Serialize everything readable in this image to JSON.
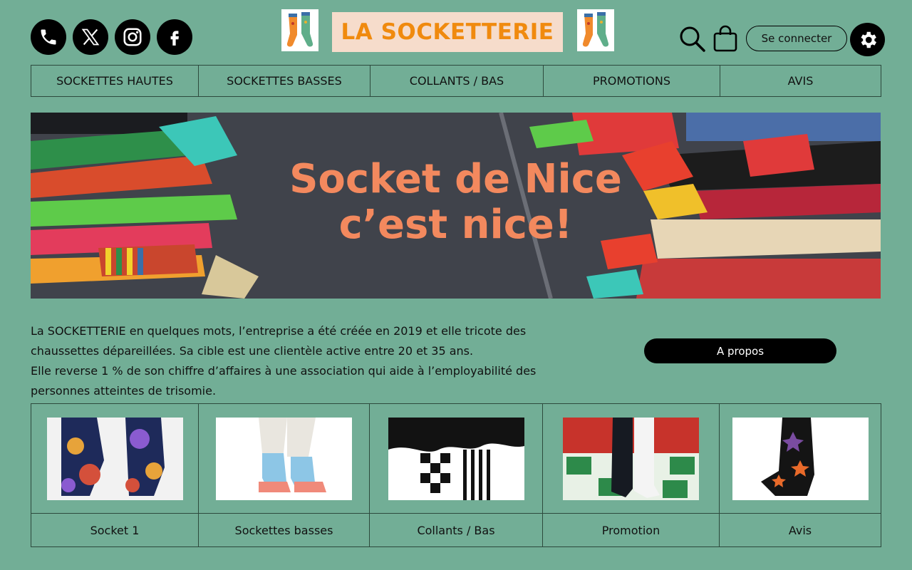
{
  "header": {
    "logo_text": "LA SOCKETTERIE",
    "social_icons": [
      "phone-icon",
      "x-icon",
      "instagram-icon",
      "facebook-icon"
    ],
    "login_label": "Se connecter"
  },
  "nav": {
    "items": [
      {
        "label": "SOCKETTES HAUTES"
      },
      {
        "label": "SOCKETTES BASSES"
      },
      {
        "label": "COLLANTS / BAS"
      },
      {
        "label": "PROMOTIONS"
      },
      {
        "label": "AVIS"
      }
    ]
  },
  "hero": {
    "title_line1": "Socket de Nice",
    "title_line2": "c’est nice!"
  },
  "about": {
    "line1": "La SOCKETTERIE en quelques mots, l’entreprise a été créée en 2019 et elle tricote des chaussettes dépareillées. Sa cible est une clientèle active entre 20 et 35 ans.",
    "line2": "Elle reverse 1 % de son chiffre d’affaires à une association qui aide à l’employabilité des personnes atteintes de trisomie.",
    "button_label": "A propos"
  },
  "products": [
    {
      "label": "Socket 1"
    },
    {
      "label": "Sockettes basses"
    },
    {
      "label": "Collants / Bas"
    },
    {
      "label": "Promotion"
    },
    {
      "label": "Avis"
    }
  ],
  "colors": {
    "background": "#72ae96",
    "logo_text": "#f08a0e",
    "logo_box": "#f6dccb",
    "hero_title": "#f3895e"
  }
}
